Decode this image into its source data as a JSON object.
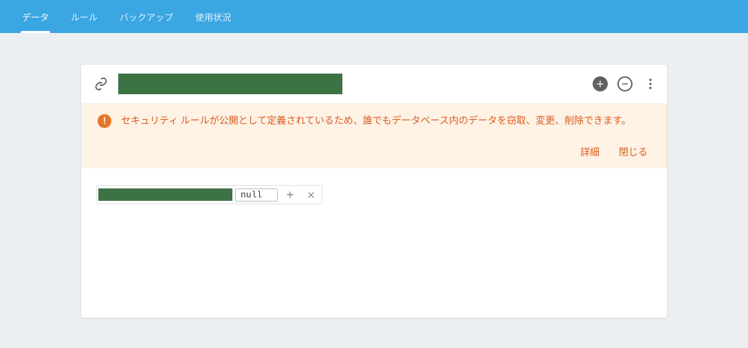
{
  "tabs": {
    "data": "データ",
    "rules": "ルール",
    "backup": "バックアップ",
    "usage": "使用状況"
  },
  "warning": {
    "message": "セキュリティ ルールが公開として定義されているため、誰でもデータベース内のデータを窃取、変更、削除できます。",
    "detail": "詳細",
    "close": "閉じる"
  },
  "data_tree": {
    "root_value": "null"
  },
  "icons": {
    "link": "link-icon",
    "add": "plus-circle-icon",
    "remove": "minus-circle-icon",
    "more": "more-vert-icon",
    "warn": "warning-icon",
    "row_add": "plus-icon",
    "row_remove": "close-icon"
  }
}
